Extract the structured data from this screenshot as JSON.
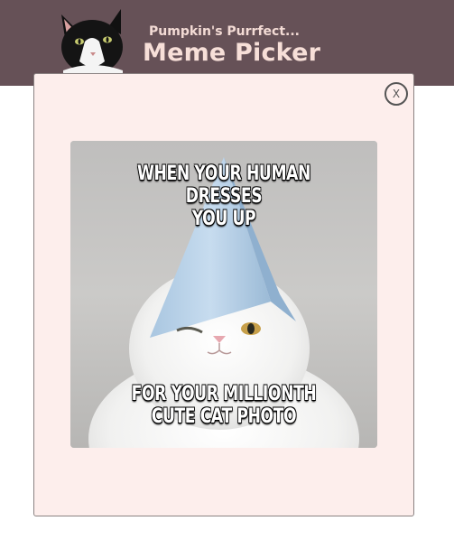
{
  "header": {
    "subtitle": "Pumpkin's Purrfect...",
    "title": "Meme Picker",
    "background_color": "#665157",
    "logo_icon": "tuxedo-cat-icon"
  },
  "modal": {
    "close_label": "X",
    "background_color": "#fdeeec",
    "meme": {
      "top_text_line1": "WHEN YOUR HUMAN DRESSES",
      "top_text_line2": "YOU UP",
      "bottom_text_line1": "FOR YOUR MILLIONTH",
      "bottom_text_line2": "CUTE CAT PHOTO",
      "image_icon": "white-cat-party-hat-image"
    }
  }
}
